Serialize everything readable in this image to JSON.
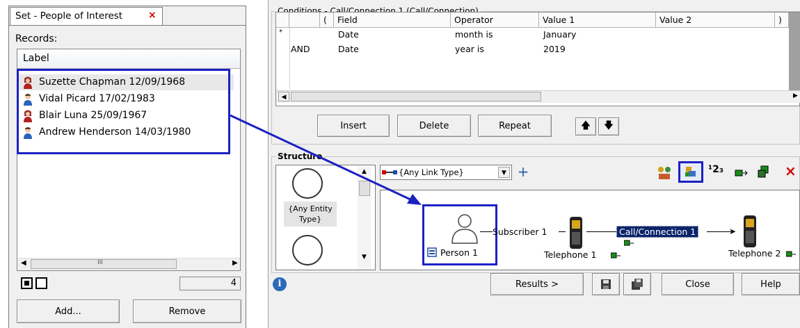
{
  "left_panel": {
    "tab_title": "Set - People of Interest",
    "tab_close": "×",
    "records_label": "Records:",
    "column_header": "Label",
    "records": [
      {
        "label": "Suzette Chapman 12/09/1968",
        "gender": "female"
      },
      {
        "label": "Vidal Picard 17/02/1983",
        "gender": "male"
      },
      {
        "label": "Blair Luna 25/09/1967",
        "gender": "female"
      },
      {
        "label": "Andrew Henderson 14/03/1980",
        "gender": "male"
      }
    ],
    "scroll_glyph": "III",
    "count": "4",
    "add_label": "Add...",
    "remove_label": "Remove"
  },
  "conditions": {
    "title": "Conditions - Call/Connection 1 (Call/Connection)",
    "headers": [
      "(",
      "Field",
      "Operator",
      "Value 1",
      "Value 2",
      ")"
    ],
    "rows": [
      {
        "marker": "*",
        "logic": "",
        "field": "Date",
        "operator": "month is",
        "value1": "January"
      },
      {
        "marker": "",
        "logic": "AND",
        "field": "Date",
        "operator": "year is",
        "value1": "2019"
      }
    ],
    "insert_label": "Insert",
    "delete_label": "Delete",
    "repeat_label": "Repeat",
    "up_glyph": "🡅",
    "down_glyph": "🡇"
  },
  "structure": {
    "title": "Structure",
    "entity_type": "{Any Entity Type}",
    "link_type": "{Any Link Type}",
    "add_glyph": "+",
    "toolbar_number": "¹2₃",
    "person": "Person 1",
    "subscriber_link": "Subscriber 1",
    "call_link": "Call/Connection 1",
    "telephone1": "Telephone 1",
    "telephone2": "Telephone 2"
  },
  "footer": {
    "results_label": "Results >",
    "close_label": "Close",
    "help_label": "Help"
  },
  "colors": {
    "highlight": "#1c21c2",
    "selection": "#0a246a"
  }
}
